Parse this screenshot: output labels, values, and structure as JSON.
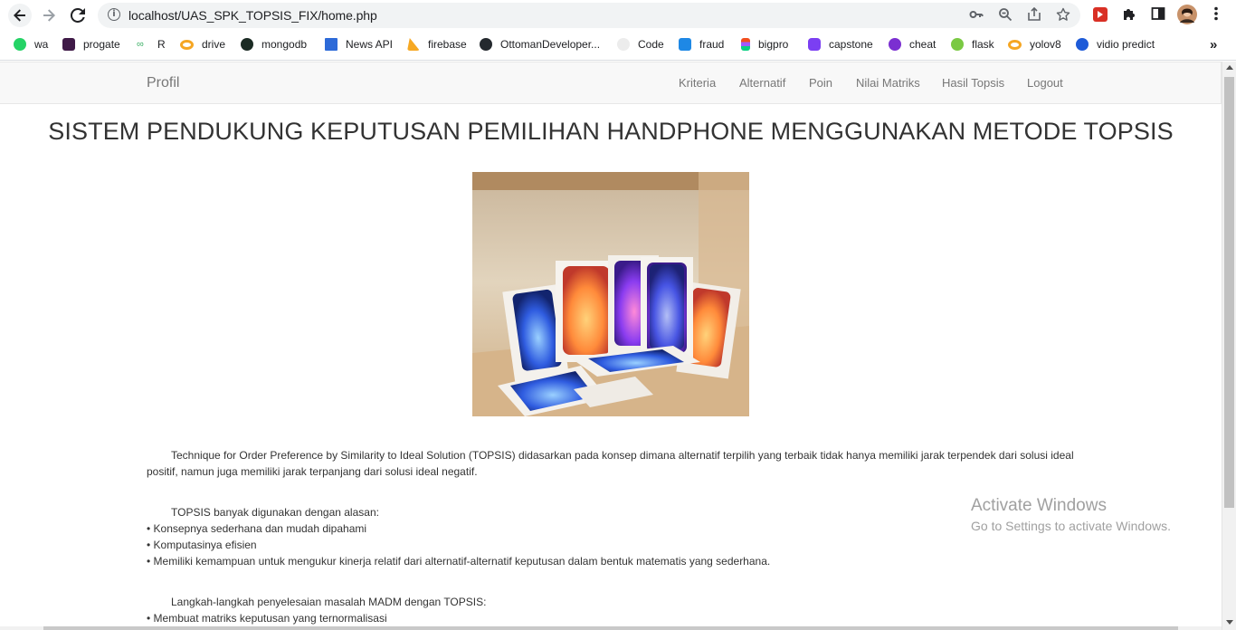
{
  "browser": {
    "url": "localhost/UAS_SPK_TOPSIS_FIX/home.php",
    "bookmarks": [
      {
        "label": "wa",
        "icon": "whatsapp-icon",
        "color": "#25d366"
      },
      {
        "label": "progate",
        "icon": "progate-icon",
        "color": "#3f1a47"
      },
      {
        "label": "R",
        "icon": "r-icon",
        "color": "#3fb168"
      },
      {
        "label": "drive",
        "icon": "drive-icon",
        "color": "#f5a623"
      },
      {
        "label": "mongodb",
        "icon": "mongodb-icon",
        "color": "#1b2b24"
      },
      {
        "label": "News API",
        "icon": "news-icon",
        "color": "#2d6ad8"
      },
      {
        "label": "firebase",
        "icon": "firebase-icon",
        "color": "#f6a823"
      },
      {
        "label": "OttomanDeveloper...",
        "icon": "github-icon",
        "color": "#24292e"
      },
      {
        "label": "Code",
        "icon": "code-icon",
        "color": "#e0e0e0"
      },
      {
        "label": "fraud",
        "icon": "fraud-icon",
        "color": "#1e88e5"
      },
      {
        "label": "bigpro",
        "icon": "figma-icon",
        "color": "#e8407a"
      },
      {
        "label": "capstone",
        "icon": "capstone-icon",
        "color": "#7b3ff2"
      },
      {
        "label": "cheat",
        "icon": "cheat-icon",
        "color": "#7b2fd1"
      },
      {
        "label": "flask",
        "icon": "flask-icon",
        "color": "#7ac943"
      },
      {
        "label": "yolov8",
        "icon": "yolo-icon",
        "color": "#f5a623"
      },
      {
        "label": "vidio predict",
        "icon": "vidio-icon",
        "color": "#1e5bd8"
      }
    ],
    "more_bookmarks": "»"
  },
  "navbar": {
    "brand": "Profil",
    "links": [
      "Kriteria",
      "Alternatif",
      "Poin",
      "Nilai Matriks",
      "Hasil Topsis",
      "Logout"
    ]
  },
  "main": {
    "title": "SISTEM PENDUKUNG KEPUTUSAN PEMILIHAN HANDPHONE MENGGUNAKAN METODE TOPSIS",
    "intro": "Technique for Order Preference by Similarity to Ideal Solution (TOPSIS) didasarkan pada konsep dimana alternatif terpilih yang terbaik tidak hanya memiliki jarak terpendek dari solusi ideal positif, namun juga memiliki jarak terpanjang dari solusi ideal negatif.",
    "reasons_heading": "TOPSIS banyak digunakan dengan alasan:",
    "reasons": [
      "• Konsepnya sederhana dan mudah dipahami",
      "• Komputasinya efisien",
      "• Memiliki kemampuan untuk mengukur kinerja relatif dari alternatif-alternatif keputusan dalam bentuk matematis yang sederhana."
    ],
    "steps_heading": "Langkah-langkah penyelesaian masalah MADM dengan TOPSIS:",
    "steps": [
      "• Membuat matriks keputusan yang ternormalisasi"
    ]
  },
  "watermark": {
    "line1": "Activate Windows",
    "line2": "Go to Settings to activate Windows."
  }
}
